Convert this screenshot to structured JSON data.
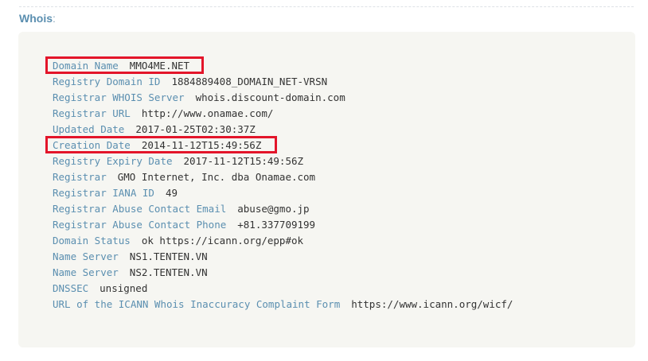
{
  "section": {
    "heading": "Whois",
    "colon": ":"
  },
  "whois": {
    "rows": [
      {
        "key": "Domain Name",
        "value": "MMO4ME.NET"
      },
      {
        "key": "Registry Domain ID",
        "value": "1884889408_DOMAIN_NET-VRSN"
      },
      {
        "key": "Registrar WHOIS Server",
        "value": "whois.discount-domain.com"
      },
      {
        "key": "Registrar URL",
        "value": "http://www.onamae.com/"
      },
      {
        "key": "Updated Date",
        "value": "2017-01-25T02:30:37Z"
      },
      {
        "key": "Creation Date",
        "value": "2014-11-12T15:49:56Z"
      },
      {
        "key": "Registry Expiry Date",
        "value": "2017-11-12T15:49:56Z"
      },
      {
        "key": "Registrar",
        "value": "GMO Internet, Inc. dba Onamae.com"
      },
      {
        "key": "Registrar IANA ID",
        "value": "49"
      },
      {
        "key": "Registrar Abuse Contact Email",
        "value": "abuse@gmo.jp"
      },
      {
        "key": "Registrar Abuse Contact Phone",
        "value": "+81.337709199"
      },
      {
        "key": "Domain Status",
        "value": "ok https://icann.org/epp#ok"
      },
      {
        "key": "Name Server",
        "value": "NS1.TENTEN.VN"
      },
      {
        "key": "Name Server",
        "value": "NS2.TENTEN.VN"
      },
      {
        "key": "DNSSEC",
        "value": "unsigned"
      },
      {
        "key": "URL of the ICANN Whois Inaccuracy Complaint Form",
        "value": "https://www.icann.org/wicf/"
      }
    ]
  },
  "colors": {
    "heading": "#5b8fb0",
    "key": "#5b8fb0",
    "value": "#333333",
    "box_background": "#f6f6f2",
    "highlight": "#e3152a"
  }
}
